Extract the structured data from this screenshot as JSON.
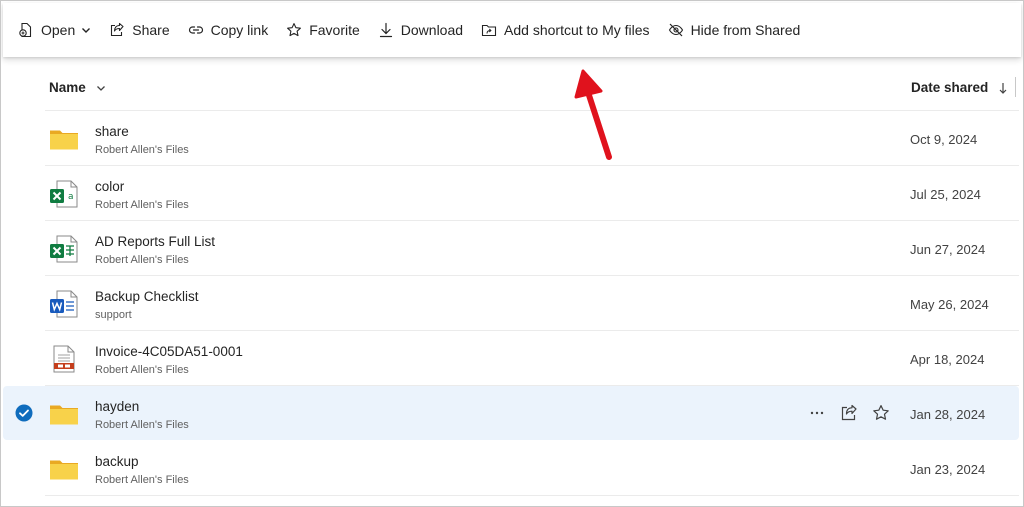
{
  "toolbar": {
    "open_label": "Open",
    "share_label": "Share",
    "copy_link_label": "Copy link",
    "favorite_label": "Favorite",
    "download_label": "Download",
    "add_shortcut_label": "Add shortcut to My files",
    "hide_label": "Hide from Shared"
  },
  "columns": {
    "name": "Name",
    "date_shared": "Date shared"
  },
  "rows": [
    {
      "name": "share",
      "sub": "Robert Allen's Files",
      "date": "Oct 9, 2024",
      "type": "folder-icon",
      "selected": false
    },
    {
      "name": "color",
      "sub": "Robert Allen's Files",
      "date": "Jul 25, 2024",
      "type": "excel-icon",
      "selected": false
    },
    {
      "name": "AD Reports Full List",
      "sub": "Robert Allen's Files",
      "date": "Jun 27, 2024",
      "type": "excel-icon",
      "selected": false
    },
    {
      "name": "Backup Checklist",
      "sub": "support",
      "date": "May 26, 2024",
      "type": "word-icon",
      "selected": false
    },
    {
      "name": "Invoice-4C05DA51-0001",
      "sub": "Robert Allen's Files",
      "date": "Apr 18, 2024",
      "type": "document-icon",
      "selected": false
    },
    {
      "name": "hayden",
      "sub": "Robert Allen's Files",
      "date": "Jan 28, 2024",
      "type": "folder-icon",
      "selected": true
    },
    {
      "name": "backup",
      "sub": "Robert Allen's Files",
      "date": "Jan 23, 2024",
      "type": "folder-icon",
      "selected": false
    }
  ],
  "colors": {
    "accent": "#0f6cbd",
    "selected_row": "#ebf3fc",
    "folder": "#f4c542",
    "excel": "#107c41",
    "word": "#185abd",
    "annotation_arrow": "#e0121d"
  }
}
